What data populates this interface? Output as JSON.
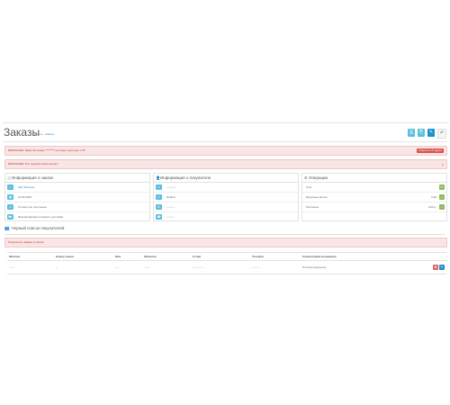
{
  "header": {
    "title": "Заказы",
    "breadcrumb": [
      {
        "label": "Главная"
      },
      {
        "label": "Заказы"
      }
    ],
    "toolbar": {
      "print_invoice": "⎙",
      "print_shipping": "⎘",
      "edit": "✎",
      "back": "↶"
    }
  },
  "alerts": {
    "warning_blacklist": "ВНИМАНИЕ: Заказ № номер ********* не может доступен с IP!",
    "reset_label": "Сбросить IP адрес",
    "warning_ip": "ВНИМАНИЕ: IP в черный список вылет!"
  },
  "order_info": {
    "title": "Информация о заказе",
    "store": "Мой Магазин",
    "date": "22.06.2018",
    "payment": "Оплата при получении",
    "shipping": "Фиксированная стоимость доставки"
  },
  "customer_info": {
    "title": "Информация о покупателе",
    "name": "•••• ••••••••",
    "group": "Default",
    "email": "••••••••••••",
    "phone": "•••••••••••"
  },
  "operations": {
    "title": "Операции",
    "rows": [
      {
        "label": "Счет",
        "amount": ""
      },
      {
        "label": "Бонусные баллы",
        "amount": "0,00"
      },
      {
        "label": "Партнеры",
        "amount": "0,00 р."
      }
    ]
  },
  "blacklist": {
    "title": "Черный список покупателей",
    "warning": "Покупатель найден в списке",
    "columns": [
      "Магазин",
      "Номер заказа",
      "Имя",
      "Фамилия",
      "E-mail",
      "Телефон",
      "Комментарий менеджера",
      ""
    ],
    "rows": [
      {
        "store": "••••••",
        "order": "••",
        "firstname": "••••",
        "lastname": "•••••••",
        "email": "••••••••••••",
        "phone": "••••••••",
        "comment": "Плохой покупатель"
      }
    ],
    "delete": "✖",
    "edit": "✎"
  },
  "colors": {
    "primary": "#1e91cf",
    "info": "#5bc0de",
    "danger": "#d9534f",
    "alert_bg": "#f8e5e5",
    "success": "#8fbb5c"
  }
}
